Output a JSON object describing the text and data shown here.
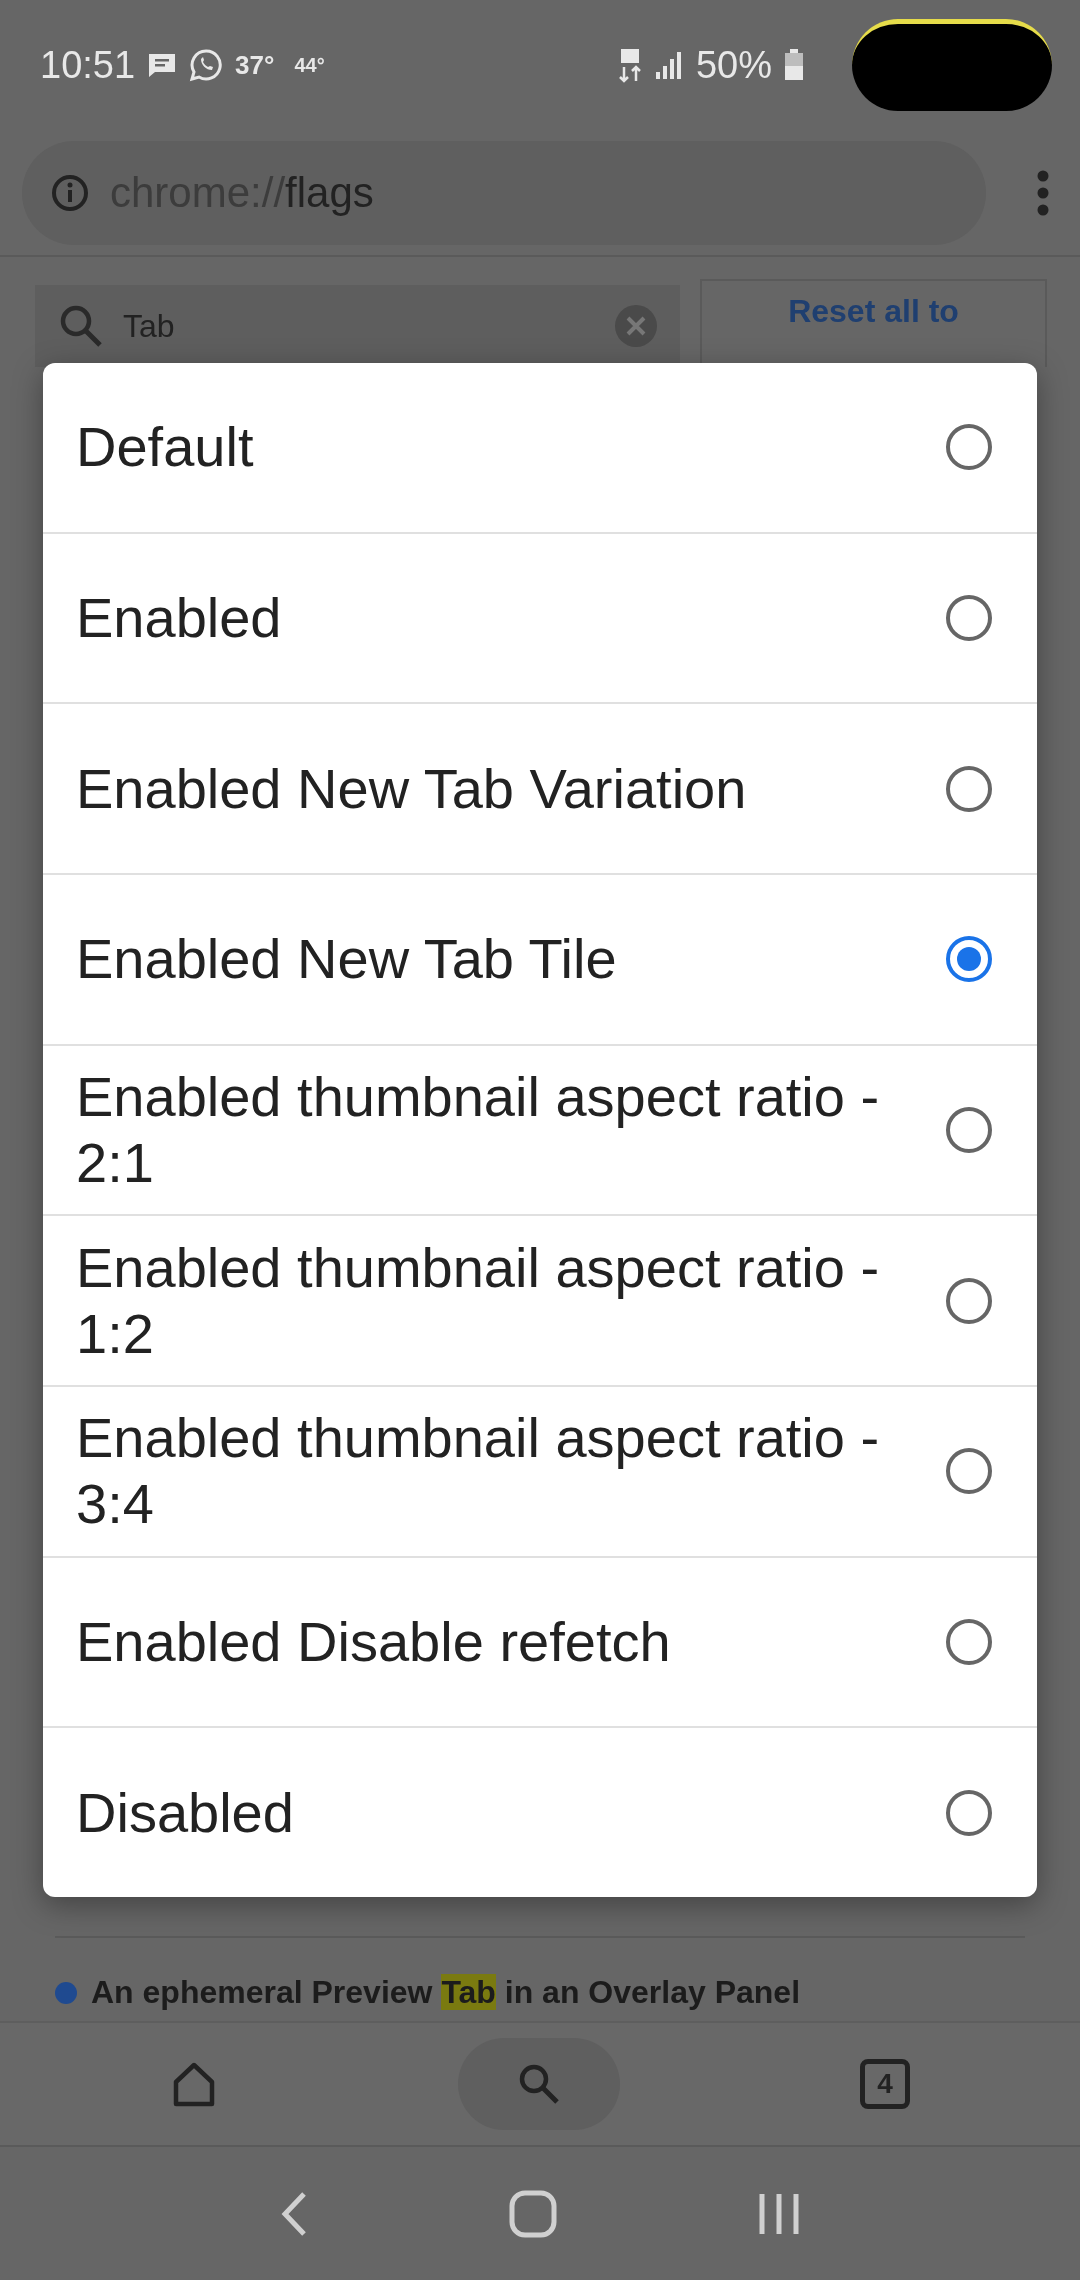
{
  "status_bar": {
    "time": "10:51",
    "temperature_1": "37°",
    "temperature_2": "44°",
    "battery": "50%"
  },
  "url_bar": {
    "url_scheme": "chrome://",
    "url_host": "flags"
  },
  "search": {
    "value": "Tab"
  },
  "reset_button": {
    "label": "Reset all to"
  },
  "options": [
    {
      "label": "Default",
      "selected": false
    },
    {
      "label": "Enabled",
      "selected": false
    },
    {
      "label": "Enabled New Tab Variation",
      "selected": false
    },
    {
      "label": "Enabled New Tab Tile",
      "selected": true
    },
    {
      "label": "Enabled thumbnail aspect ratio - 2:1",
      "selected": false
    },
    {
      "label": "Enabled thumbnail aspect ratio - 1:2",
      "selected": false
    },
    {
      "label": "Enabled thumbnail aspect ratio - 3:4",
      "selected": false
    },
    {
      "label": "Enabled Disable refetch",
      "selected": false
    },
    {
      "label": "Disabled",
      "selected": false
    }
  ],
  "flag_item": {
    "text_before": "An ephemeral Preview ",
    "highlight": "Tab",
    "text_after": " in an Overlay Panel"
  },
  "toolbar": {
    "tab_count": "4"
  }
}
